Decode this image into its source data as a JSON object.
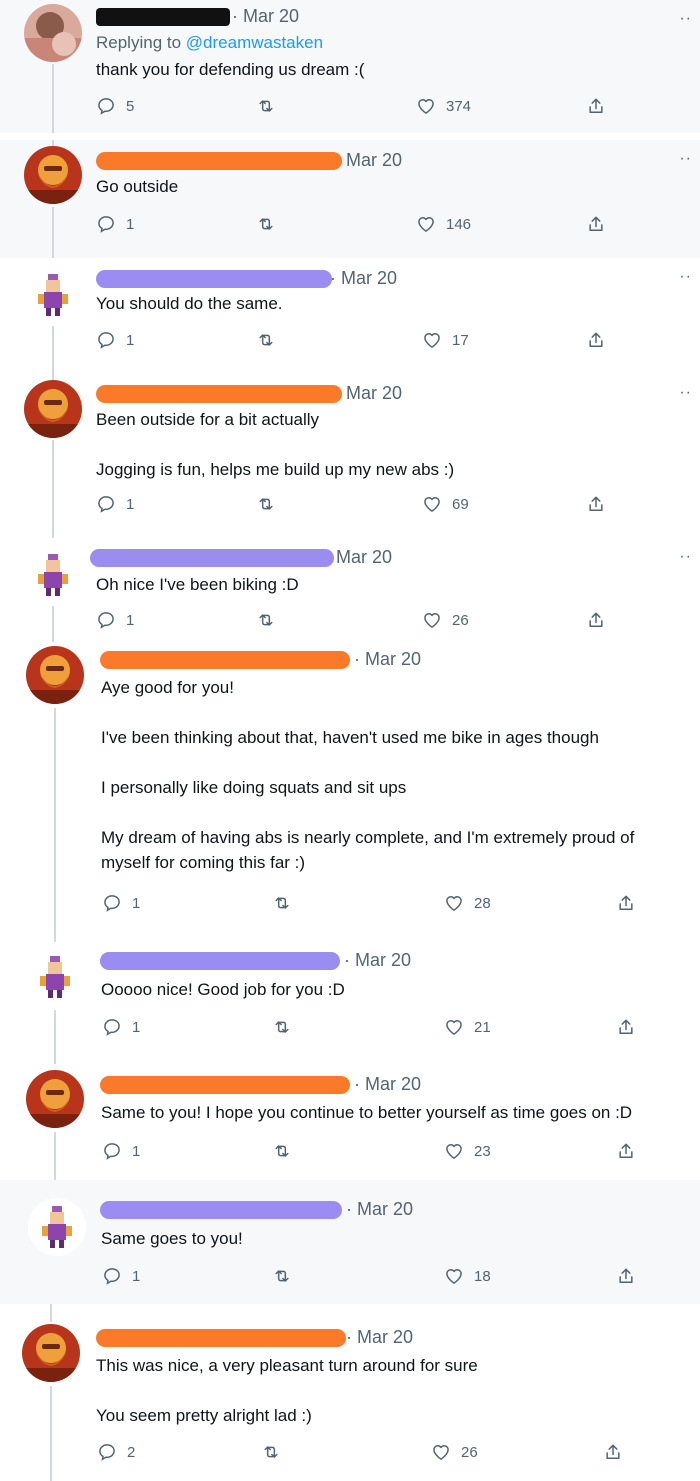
{
  "tweets": [
    {
      "date": "Mar 20",
      "reply_prefix": "Replying to ",
      "reply_handle": "@dreamwastaken",
      "lines": [
        "thank you for defending us dream :("
      ],
      "replies": "5",
      "likes": "374"
    },
    {
      "date": "Mar 20",
      "lines": [
        "Go outside"
      ],
      "replies": "1",
      "likes": "146"
    },
    {
      "date": "Mar 20",
      "lines": [
        "You should do the same."
      ],
      "replies": "1",
      "likes": "17"
    },
    {
      "date": "Mar 20",
      "lines": [
        "Been outside for a bit actually",
        "Jogging is fun, helps me build up my new abs :)"
      ],
      "replies": "1",
      "likes": "69"
    },
    {
      "date": "Mar 20",
      "lines": [
        "Oh nice I've been biking :D"
      ],
      "replies": "1",
      "likes": "26"
    },
    {
      "date": "Mar 20",
      "lines": [
        "Aye good for you!",
        "I've been thinking about that, haven't used me bike in ages though",
        "I personally like doing squats and sit ups",
        "My dream of having abs is nearly complete, and I'm extremely proud of",
        "myself for coming this far :)"
      ],
      "replies": "1",
      "likes": "28"
    },
    {
      "date": "Mar 20",
      "lines": [
        "Ooooo nice! Good job for you :D"
      ],
      "replies": "1",
      "likes": "21"
    },
    {
      "date": "Mar 20",
      "lines": [
        "Same to you! I hope you continue to better yourself as time goes on :D"
      ],
      "replies": "1",
      "likes": "23"
    },
    {
      "date": "Mar 20",
      "lines": [
        "Same goes to you!"
      ],
      "replies": "1",
      "likes": "18"
    },
    {
      "date": "Mar 20",
      "lines": [
        "This was nice, a very pleasant turn around for sure",
        "You seem pretty alright lad :)"
      ],
      "replies": "2",
      "likes": "26"
    }
  ],
  "colors": {
    "redact_orange": "#fa7a2a",
    "redact_purple": "#9a8cf0",
    "link_blue": "#1d9bf0",
    "muted_gray": "#536471"
  },
  "icons": [
    "reply-icon",
    "retweet-icon",
    "like-icon",
    "share-icon",
    "more-icon"
  ]
}
